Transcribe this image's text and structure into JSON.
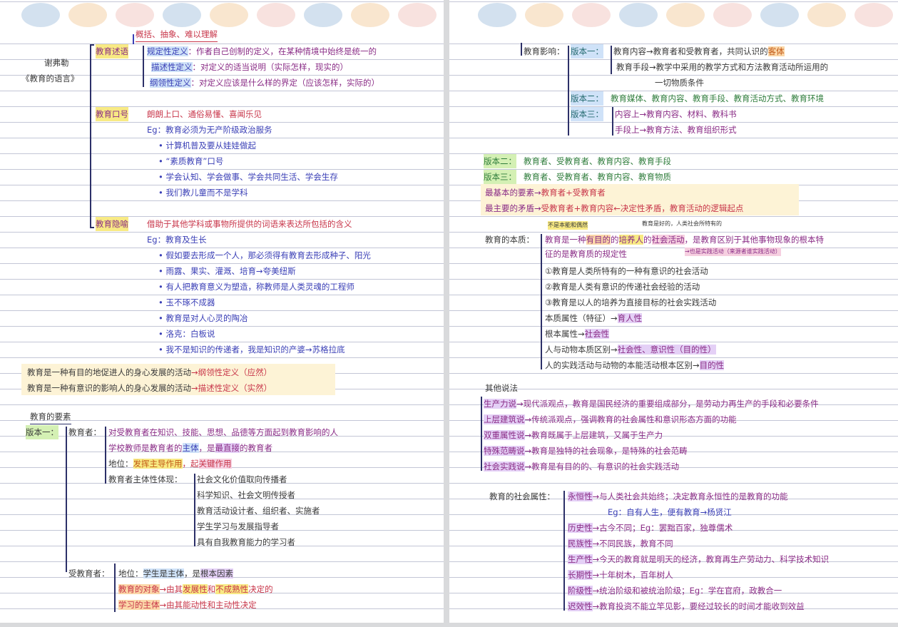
{
  "palette": {
    "ink": "#2c3068",
    "purple": "#8a2c86",
    "red": "#c8364a",
    "blue": "#3a3fb6",
    "green": "#2f7d3c",
    "yellow_hl": "#f8ea84",
    "blue_hl": "#cfe2f8",
    "green_hl": "#d4f0b4",
    "purple_hl": "#e4d0f6",
    "pink_hl": "#f6cfe0"
  },
  "dot_colors": [
    "#d3e1ef",
    "#f9e6cf",
    "#f8e2df",
    "#d3e1ef",
    "#f9e6cf",
    "#f8e2df",
    "#d3e1ef",
    "#f9e6cf",
    "#f8e2df"
  ],
  "left": {
    "top_note": "概括、抽象、难以理解",
    "author": "谢弗勒",
    "book": "《教育的语言》",
    "shuyu": {
      "label": "教育述语",
      "items": [
        {
          "h": "规定性定义",
          "t": "作者自己创制的定义，在某种情境中始终是统一的"
        },
        {
          "h": "描述性定义",
          "t": "对定义的适当说明（实际怎样，现实的）"
        },
        {
          "h": "纲领性定义",
          "t": "对定义应该是什么样的界定（应该怎样，实际的）"
        }
      ]
    },
    "kouhao": {
      "label": "教育口号",
      "text": "朗朗上口、通俗易懂、喜闻乐见",
      "eg": "Eg：教育必须为无产阶级政治服务",
      "bullets": [
        "• 计算机普及要从娃娃做起",
        "• “素质教育”口号",
        "• 学会认知、学会做事、学会共同生活、学会生存",
        "• 我们教儿童而不是学科"
      ]
    },
    "yinyu": {
      "label": "教育隐喻",
      "text": "借助于其他学科或事物所提供的词语来表达所包括的含义",
      "eg": "Eg：教育及生长",
      "bullets": [
        "• 假如要去形成一个人，那必须得有教育去形成种子、阳光",
        "• 雨露、果实、灌溉、培育→夸美纽斯",
        "• 有人把教育意义为塑造，称教师是人类灵魂的工程师",
        "• 玉不琢不成器",
        "• 教育是对人心灵的陶冶",
        "• 洛克：白板说",
        "• 我不是知识的传递者，我是知识的产婆→苏格拉底"
      ]
    },
    "defs": [
      {
        "t": "教育是一种有目的地促进人的身心发展的活动",
        "r": "→纲领性定义（应然）"
      },
      {
        "t": "教育是一种有意识的影响人的身心发展的活动",
        "r": "→描述性定义（实然）"
      }
    ],
    "yaosu": {
      "title": "教育的要素",
      "v1": "版本一：",
      "jiaoyuzhe": "教育者：",
      "jyz_def": "对受教育者在知识、技能、思想、品德等方面起到教育影响的人",
      "jyz_line2_pre": "学校教师是教育者的",
      "jyz_line2_h1": "主体",
      "jyz_line2_mid": "，是",
      "jyz_line2_h2": "最直接",
      "jyz_line2_post": "的教育者",
      "status_pre": "地位：",
      "status_h1": "发挥主导作用",
      "status_mid": "，起",
      "status_h2": "关键作用",
      "ztx_label": "教育者主体性体现：",
      "ztx_items": [
        "社会文化价值取向传播者",
        "科学知识、社会文明传授者",
        "教育活动设计者、组织者、实施者",
        "学生学习与发展指导者",
        "具有自我教育能力的学习者"
      ],
      "shoujiaoyuzhe": "受教育者：",
      "sj_status_pre": "地位：",
      "sj_status_h1": "学生是主体",
      "sj_status_mid": "，是",
      "sj_status_h2": "根本因素",
      "sj_duixiang_h": "教育的对象",
      "sj_duixiang_pre": "→由其",
      "sj_duixiang_h2": "发展性",
      "sj_duixiang_mid": "和",
      "sj_duixiang_h3": "不成熟性",
      "sj_duixiang_post": "决定的",
      "sj_zhuti_h": "学习的主体",
      "sj_zhuti_post": "→由其能动性和主动性决定"
    }
  },
  "right": {
    "yingxiang": "教育影响：",
    "v1_label": "版本一：",
    "v1_line1_pre": "教育内容→教育者和受教育者，共同认识的",
    "v1_line1_h": "客体",
    "v1_line2": "教育手段→教学中采用的教学方式和方法教育活动所运用的",
    "v1_line3": "一切物质条件",
    "v2_label": "版本二：",
    "v2_text": "教育媒体、教育内容、教育手段、教育活动方式、教育环境",
    "v3_label": "版本三：",
    "v3_l1": "内容上→教育内容、材料、教科书",
    "v3_l2": "手段上→教育方法、教育组织形式",
    "bb2_label": "版本二：",
    "bb2_text": "教育者、受教育者、教育内容、教育手段",
    "bb3_label": "版本三：",
    "bb3_text": "教育者、受教育者、教育内容、教育物质",
    "basic_pre": "最基本的要素→",
    "basic_post": "教育者+受教育者",
    "main_pre": "最主要的矛盾→",
    "main_post": "受教育者+教育内容←决定性矛盾，教育活动的逻辑起点",
    "note_instinct": "不是本能和偶然",
    "note_purpose": "教育是好的，人类社会所特有的",
    "benzhi_label": "教育的本质：",
    "bz_pre": "教育是一种",
    "bz_h1": "有目的",
    "bz_mid": "的",
    "bz_h2": "培养人",
    "bz_mid2": "的",
    "bz_h3": "社会活动",
    "bz_post": "，是教育区别于其他事物现象的根本特",
    "bz_line2": "征的是教育质的规定性",
    "note_practice": "→也是实践活动（来源者谁实践活动）",
    "points": [
      "①教育是人类所特有的一种有意识的社会活动",
      "②教育是人类有意识的传递社会经验的活动",
      "③教育是以人的培养为直接目标的社会实践活动"
    ],
    "attr1_pre": "本质属性（特征）→",
    "attr1_h": "育人性",
    "attr2_pre": "根本属性→",
    "attr2_h": "社会性",
    "attr3_pre": "人与动物本质区别→",
    "attr3_h": "社会性、意识性（目的性）",
    "attr4_pre": "人的实践活动与动物的本能活动根本区别→",
    "attr4_h": "目的性",
    "other_title": "其他说法",
    "others": [
      {
        "h": "生产力说",
        "t": "→现代派观点，教育是国民经济的重要组成部分，是劳动力再生产的手段和必要条件"
      },
      {
        "h": "上层建筑说",
        "t": "→传统派观点，强调教育的社会属性和意识形态方面的功能"
      },
      {
        "h": "双重属性说",
        "t": "→教育既属于上层建筑，又属于生产力"
      },
      {
        "h": "特殊范畴说",
        "t": "→教育是独特的社会现象，是特殊的社会范畴"
      },
      {
        "h": "社会实践说",
        "t": "→教育是有目的的、有意识的社会实践活动"
      }
    ],
    "shehui_label": "教育的社会属性：",
    "social": [
      {
        "h": "永恒性",
        "t": "→与人类社会共始终；决定教育永恒性的是教育的功能"
      },
      {
        "h": "",
        "t": "Eg：自有人生，便有教育→杨贤江"
      },
      {
        "h": "历史性",
        "t": "→古今不同；Eg：罢黜百家，独尊儒术"
      },
      {
        "h": "民族性",
        "t": "→不同民族，教育不同"
      },
      {
        "h": "生产性",
        "t": "→今天的教育就是明天的经济，教育再生产劳动力、科学技术知识"
      },
      {
        "h": "长期性",
        "t": "→十年树木，百年树人"
      },
      {
        "h": "阶级性",
        "t": "→统治阶级和被统治阶级；Eg：学在官府，政教合一"
      },
      {
        "h": "迟效性",
        "t": "→教育投资不能立竿见影，要经过较长的时间才能收到效益"
      }
    ]
  }
}
